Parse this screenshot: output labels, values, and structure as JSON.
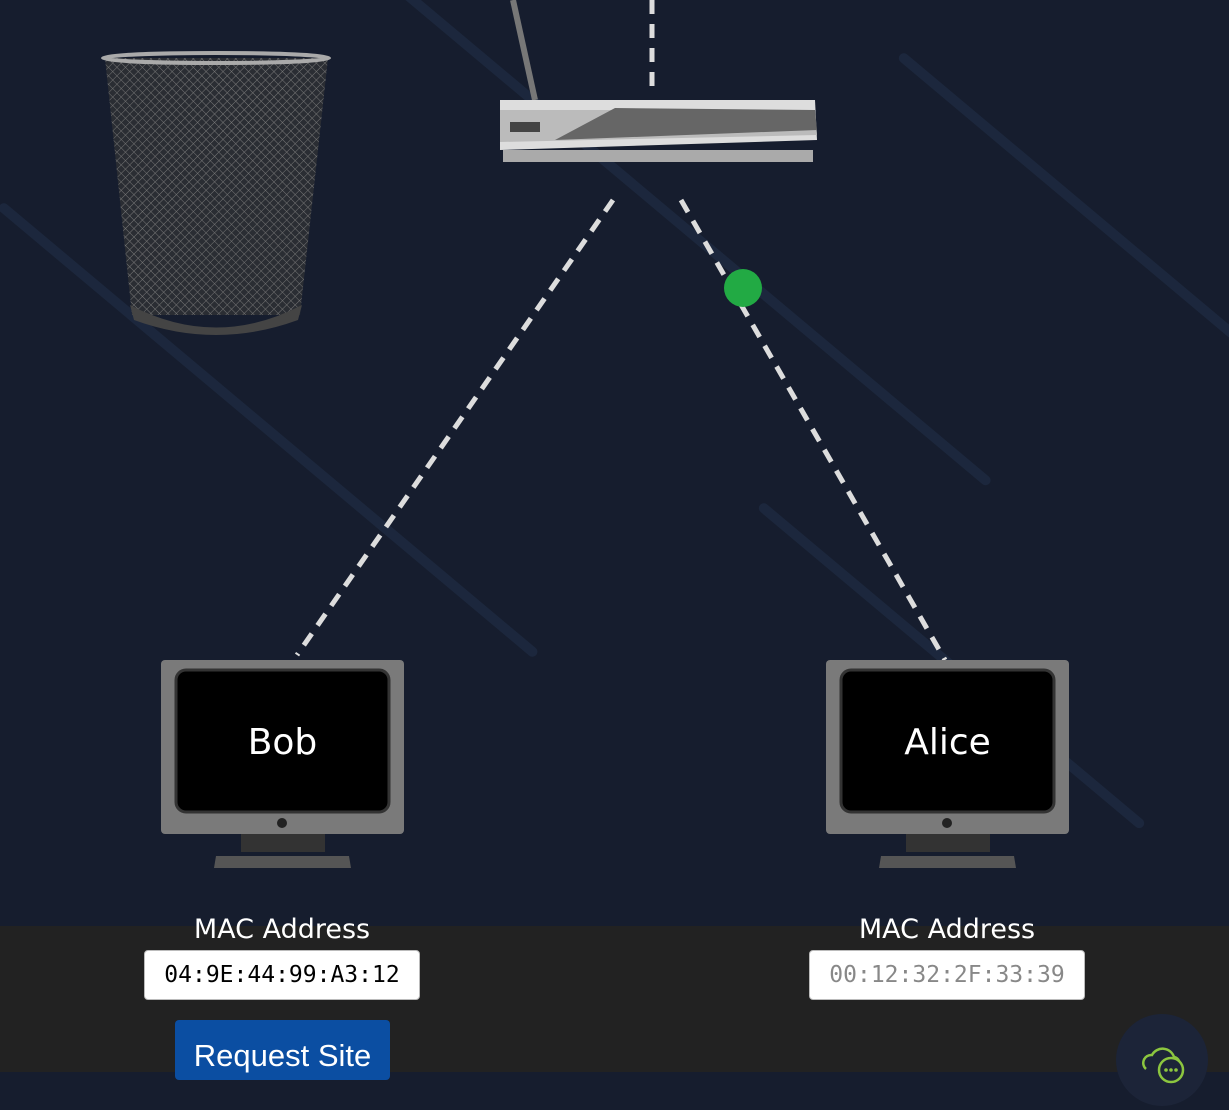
{
  "devices": {
    "bob": {
      "name": "Bob",
      "mac_label": "MAC Address",
      "mac": "04:9E:44:99:A3:12"
    },
    "alice": {
      "name": "Alice",
      "mac_label": "MAC Address",
      "mac": "00:12:32:2F:33:39"
    }
  },
  "actions": {
    "request_site": "Request Site"
  },
  "icons": {
    "trash": "trash-can-icon",
    "router": "router-icon",
    "chat": "cloud-chat-icon"
  },
  "colors": {
    "background": "#161d2e",
    "footer": "#222222",
    "packet": "#22aa44",
    "button": "#0b4ea2",
    "chat_icon": "#8cc63f"
  }
}
